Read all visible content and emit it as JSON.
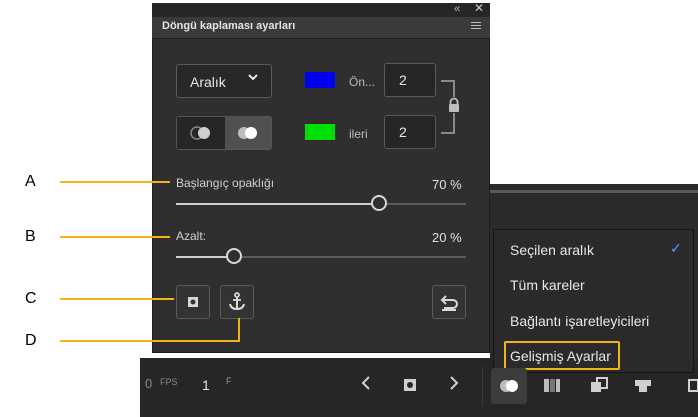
{
  "panel": {
    "title": "Döngü kaplaması ayarları",
    "range_dropdown": {
      "value": "Aralık",
      "chevron": "chevron-down-icon"
    },
    "before": {
      "label": "Ön...",
      "value": "2",
      "color": "#0000ee"
    },
    "after": {
      "label": "ileri",
      "value": "2",
      "color": "#00e000"
    },
    "start_opacity": {
      "label": "Başlangıç opaklığı",
      "value": "70 %",
      "fraction": 0.7
    },
    "reduce": {
      "label": "Azalt:",
      "value": "20 %",
      "fraction": 0.2
    }
  },
  "callouts": [
    "A",
    "B",
    "C",
    "D"
  ],
  "context_menu": {
    "items": [
      {
        "label": "Seçilen aralık",
        "checked": true
      },
      {
        "label": "Tüm kareler",
        "checked": false
      },
      {
        "label": "Bağlantı işaretleyicileri",
        "checked": false
      },
      {
        "label": "Gelişmiş Ayarlar",
        "checked": false
      }
    ],
    "check_icon": "✓"
  },
  "bottom_bar": {
    "fps_label": "FPS",
    "fps_value": "0",
    "frame_value": "1",
    "frame_suffix": "F"
  },
  "colors": {
    "accent_callout": "#f0b418",
    "check": "#4aa0ff"
  }
}
